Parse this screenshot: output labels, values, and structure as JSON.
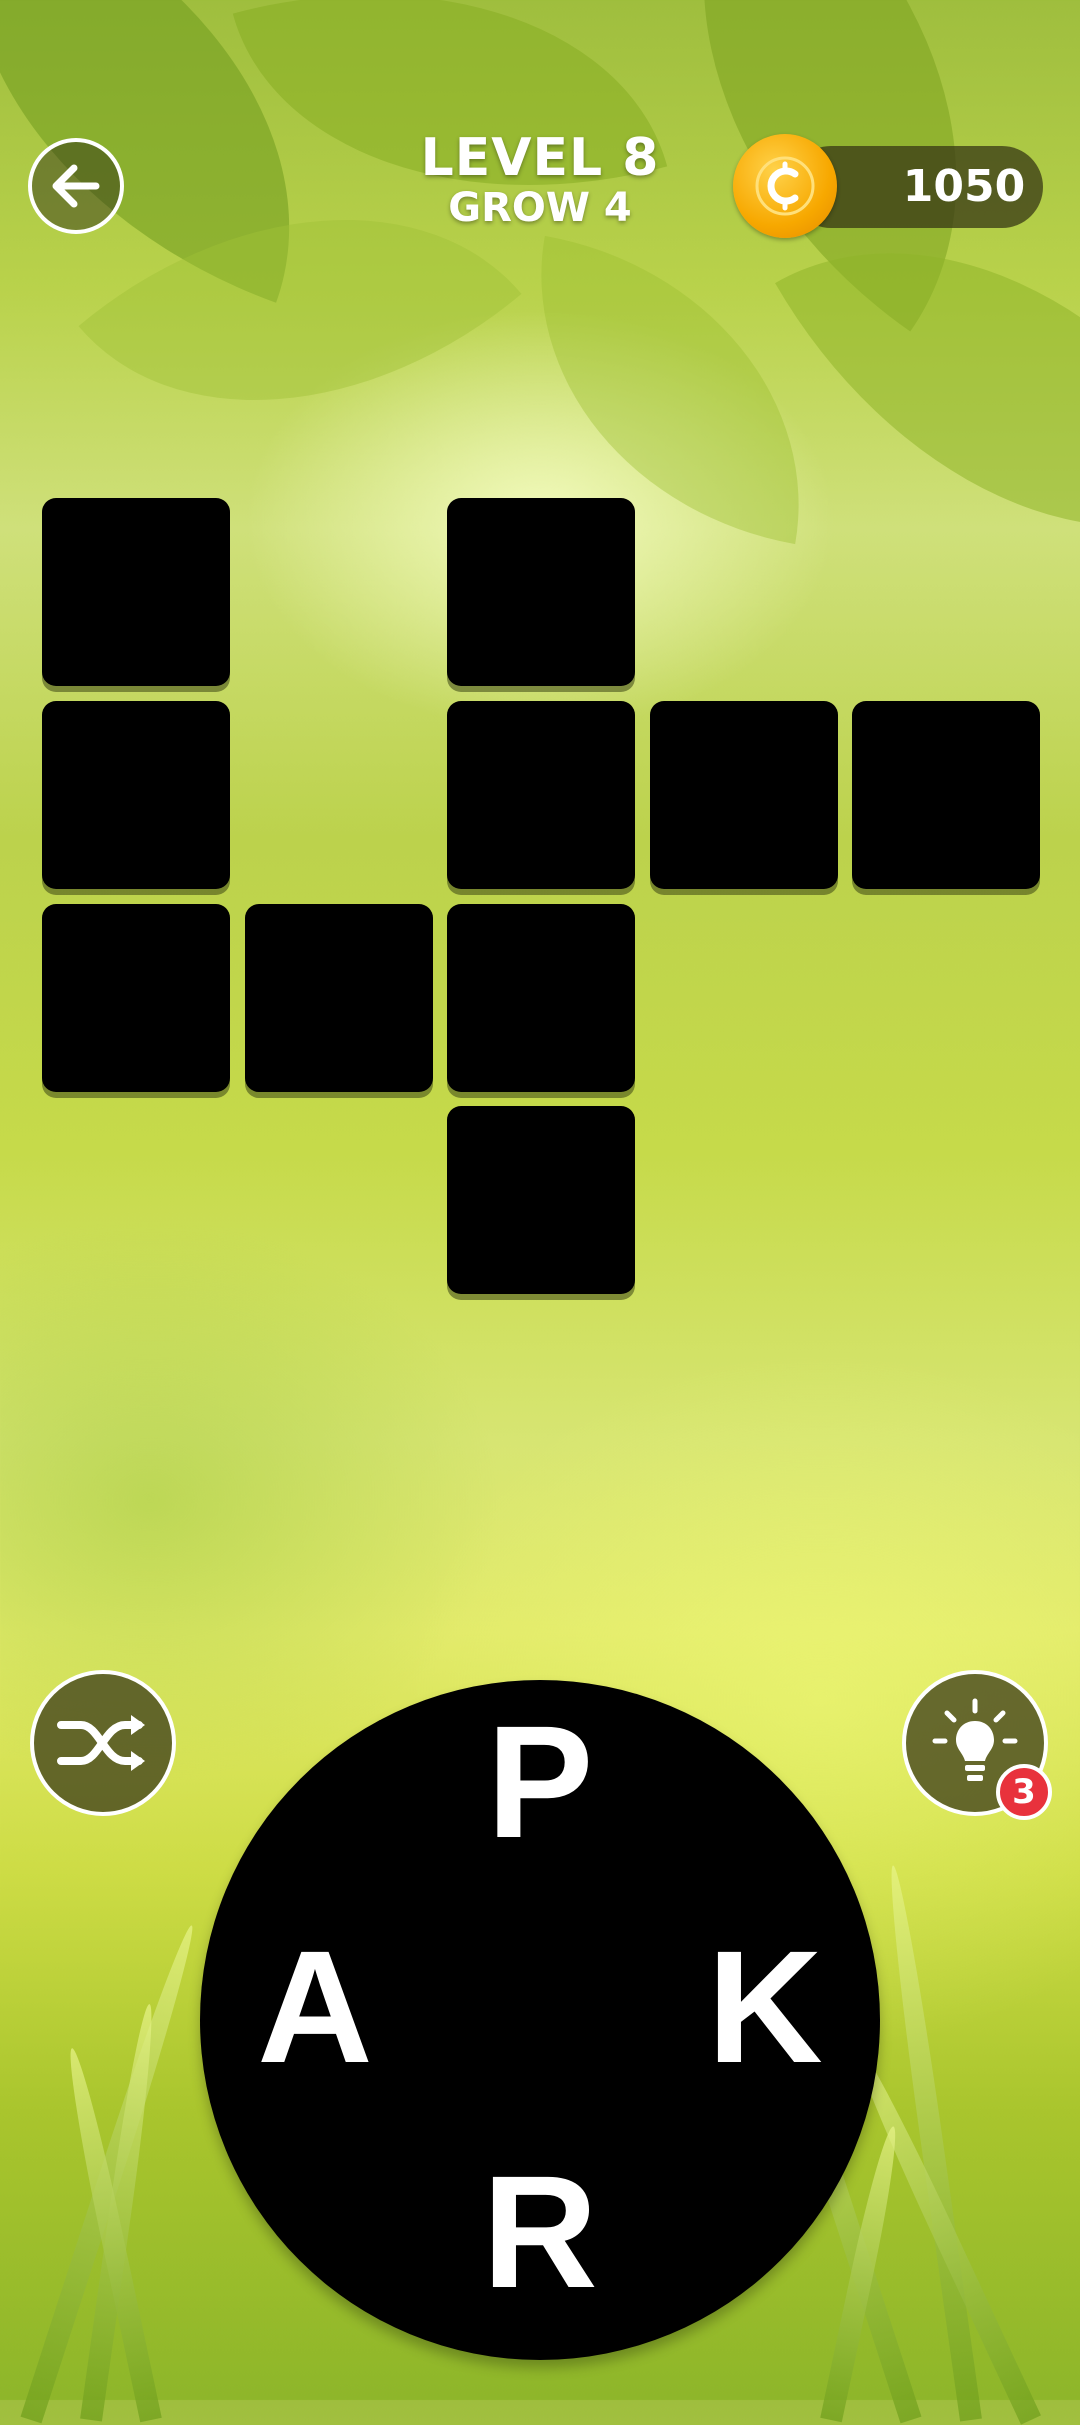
{
  "header": {
    "level_title": "LEVEL 8",
    "level_subtitle": "GROW 4",
    "coins": "1050"
  },
  "icons": {
    "back": "arrow-left-icon",
    "coin": "coin-icon",
    "shuffle": "shuffle-icon",
    "hint": "lightbulb-icon"
  },
  "grid": {
    "tiles_revealed": 0,
    "tile_count": 10
  },
  "hint": {
    "badge_count": "3"
  },
  "wheel": {
    "letters": [
      "P",
      "A",
      "K",
      "R"
    ]
  },
  "colors": {
    "tile": "#000000",
    "coin": "#f7a800",
    "badge": "#e8323c",
    "text": "#ffffff"
  }
}
